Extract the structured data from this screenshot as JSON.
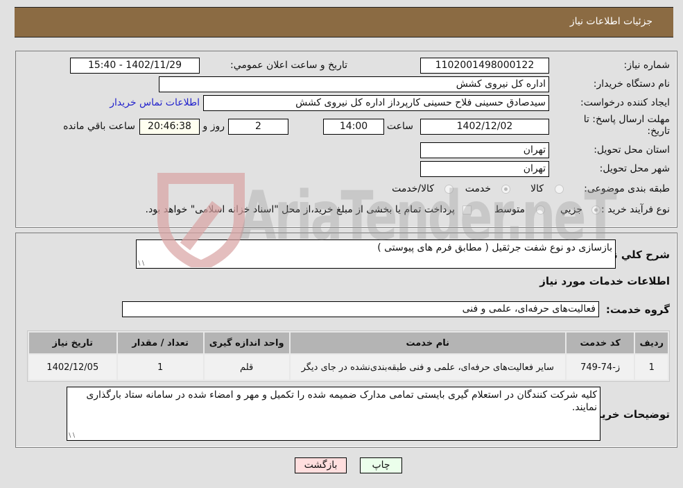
{
  "header": {
    "title": "جزئیات اطلاعات نیاز"
  },
  "details": {
    "need_number_label": "شماره نیاز:",
    "need_number": "1102001498000122",
    "announce_label": "تاریخ و ساعت اعلان عمومي:",
    "announce_value": "1402/11/29 - 15:40",
    "buyer_org_label": "نام دستگاه خریدار:",
    "buyer_org": "اداره کل نیروی کشش",
    "creator_label": "ایجاد کننده درخواست:",
    "creator": "سیدصادق حسینی فلاح حسینی کارپرداز اداره کل نیروی کشش",
    "contact_link": "اطلاعات تماس خریدار",
    "deadline_label_1": "مهلت ارسال پاسخ: تا",
    "deadline_label_2": "تاریخ:",
    "deadline_date": "1402/12/02",
    "time_label": "ساعت",
    "deadline_time": "14:00",
    "days_value": "2",
    "days_label": "روز و",
    "remaining_time": "20:46:38",
    "remaining_label": "ساعت باقي مانده",
    "province_label": "استان محل تحویل:",
    "province": "تهران",
    "city_label": "شهر محل تحویل:",
    "city": "تهران",
    "category_label": "طبقه بندی موضوعی:",
    "category_options": [
      {
        "label": "کالا",
        "checked": false
      },
      {
        "label": "خدمت",
        "checked": true
      },
      {
        "label": "کالا/خدمت",
        "checked": false
      }
    ],
    "process_label": "نوع فرآیند خرید :",
    "process_options": [
      {
        "label": "جزيي",
        "checked": true
      },
      {
        "label": "متوسط",
        "checked": false
      }
    ],
    "treasury_note": "پرداخت تمام یا بخشی از مبلغ خرید،از محل \"اسناد خزانه اسلامی\" خواهد بود.",
    "treasury_checked": false
  },
  "description": {
    "general_label": "شرح کلي نیاز:",
    "general_value": "بازسازی دو نوع شفت جرثقیل ( مطابق فرم های پیوستی )",
    "services_title": "اطلاعات خدمات مورد نیاز",
    "service_group_label": "گروه خدمت:",
    "service_group": "فعالیت‌های حرفه‌ای، علمی و فنی"
  },
  "table": {
    "headers": [
      "ردیف",
      "کد خدمت",
      "نام خدمت",
      "واحد اندازه گیری",
      "تعداد / مقدار",
      "تاریخ نیاز"
    ],
    "rows": [
      [
        "1",
        "ز-74-749",
        "سایر فعالیت‌های حرفه‌ای، علمی و فنی طبقه‌بندی‌نشده در جای دیگر",
        "قلم",
        "1",
        "1402/12/05"
      ]
    ]
  },
  "buyer_notes": {
    "label": "توضیحات خریدار:",
    "value": "کلیه شرکت کنندگان در استعلام گیری بایستی تمامی مدارک ضمیمه شده را تکمیل و مهر و امضاء شده در سامانه ستاد بارگذاری نمایند."
  },
  "buttons": {
    "print": "چاپ",
    "back": "بازگشت"
  },
  "watermark": {
    "text": "AriaTender.neT"
  }
}
